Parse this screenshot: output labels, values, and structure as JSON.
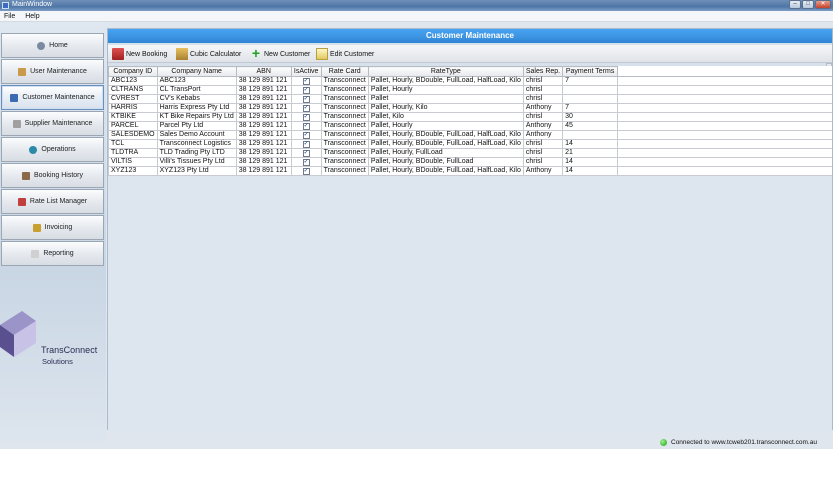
{
  "window": {
    "title": "MainWindow"
  },
  "menu": [
    "File",
    "Help"
  ],
  "sidebar": {
    "items": [
      {
        "label": "Home",
        "icon": "home-icon",
        "color": "#7a8aa0"
      },
      {
        "label": "User Maintenance",
        "icon": "users-icon",
        "color": "#c89a4a"
      },
      {
        "label": "Customer Maintenance",
        "icon": "customer-icon",
        "color": "#3a6cb4",
        "active": true
      },
      {
        "label": "Supplier Maintenance",
        "icon": "supplier-icon",
        "color": "#a0a0a0"
      },
      {
        "label": "Operations",
        "icon": "globe-icon",
        "color": "#2a8aa8"
      },
      {
        "label": "Booking History",
        "icon": "history-icon",
        "color": "#8a6a4a"
      },
      {
        "label": "Rate List Manager",
        "icon": "ratelist-icon",
        "color": "#c04040"
      },
      {
        "label": "Invoicing",
        "icon": "invoice-icon",
        "color": "#c8a030"
      },
      {
        "label": "Reporting",
        "icon": "report-icon",
        "color": "#b0b0b0"
      }
    ]
  },
  "logo": {
    "name": "TransConnect",
    "sub": "Solutions"
  },
  "main": {
    "title": "Customer Maintenance",
    "toolbar": {
      "new_booking": "New Booking",
      "cubic_calculator": "Cubic Calculator",
      "new_customer": "New Customer",
      "edit_customer": "Edit Customer"
    },
    "columns": [
      "Company ID",
      "Company Name",
      "ABN",
      "IsActive",
      "Rate Card",
      "RateType",
      "Sales Rep.",
      "Payment Terms"
    ],
    "rows": [
      [
        "ABC123",
        "ABC123",
        "38 129 891 121",
        true,
        "Transconnect",
        "Pallet, Hourly, BDouble, FullLoad, HalfLoad, Kilo",
        "chrisl",
        "7"
      ],
      [
        "CLTRANS",
        "CL TransPort",
        "38 129 891 121",
        true,
        "Transconnect",
        "Pallet, Hourly",
        "chrisl",
        ""
      ],
      [
        "CVREST",
        "CV's Kebabs",
        "38 129 891 121",
        true,
        "Transconnect",
        "Pallet",
        "chrisl",
        ""
      ],
      [
        "HARRIS",
        "Harris Express Pty Ltd",
        "38 129 891 121",
        true,
        "Transconnect",
        "Pallet, Hourly, Kilo",
        "Anthony",
        "7"
      ],
      [
        "KTBIKE",
        "KT Bike Repairs Pty Ltd",
        "38 129 891 121",
        true,
        "Transconnect",
        "Pallet, Kilo",
        "chrisl",
        "30"
      ],
      [
        "PARCEL",
        "Parcel Pty Ltd",
        "38 129 891 121",
        true,
        "Transconnect",
        "Pallet, Hourly",
        "Anthony",
        "45"
      ],
      [
        "SALESDEMO",
        "Sales Demo Account",
        "38 129 891 121",
        true,
        "Transconnect",
        "Pallet, Hourly, BDouble, FullLoad, HalfLoad, Kilo",
        "Anthony",
        ""
      ],
      [
        "TCL",
        "Transconnect Logistics",
        "38 129 891 121",
        true,
        "Transconnect",
        "Pallet, Hourly, BDouble, FullLoad, HalfLoad, Kilo",
        "chrisl",
        "14"
      ],
      [
        "TLDTRA",
        "TLD Trading Pty LTD",
        "38 129 891 121",
        true,
        "Transconnect",
        "Pallet, Hourly, FullLoad",
        "chrisl",
        "21"
      ],
      [
        "VILTIS",
        "Villi's Tissues Pty Ltd",
        "38 129 891 121",
        true,
        "Transconnect",
        "Pallet, Hourly, BDouble, FullLoad",
        "chrisl",
        "14"
      ],
      [
        "XYZ123",
        "XYZ123 Pty Ltd",
        "38 129 891 121",
        true,
        "Transconnect",
        "Pallet, Hourly, BDouble, FullLoad, HalfLoad, Kilo",
        "Anthony",
        "14"
      ]
    ]
  },
  "status": {
    "text": "Connected to www.tcweb201.transconnect.com.au",
    "color": "#22aa22"
  }
}
